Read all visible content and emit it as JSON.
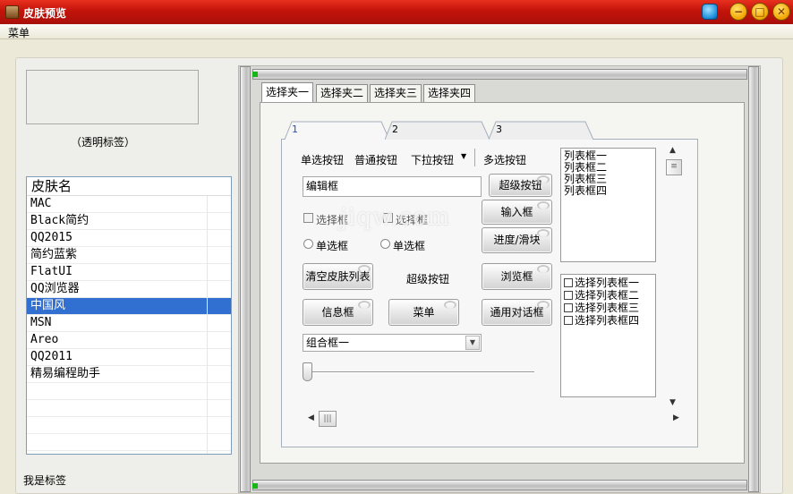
{
  "window": {
    "title": "皮肤预览",
    "minimize_glyph": "−",
    "maximize_glyph": "□",
    "close_glyph": "✕"
  },
  "menubar": {
    "menu_label": "菜单"
  },
  "left": {
    "transparent_label": "（透明标签）",
    "skin_list": {
      "header": "皮肤名",
      "items": [
        "MAC",
        "Black简约",
        "QQ2015",
        "简约蓝紫",
        "FlatUI",
        "QQ浏览器",
        "中国风",
        "MSN",
        "Areo",
        "QQ2011",
        "精易编程助手"
      ],
      "selected": "中国风"
    },
    "bottom_label": "我是标签"
  },
  "outer_tabs": [
    "选择夹一",
    "选择夹二",
    "选择夹三",
    "选择夹四"
  ],
  "inner_tabs": [
    "1",
    "2",
    "3"
  ],
  "controls": {
    "radio_button_label": "单选按钮",
    "normal_button_label": "普通按钮",
    "dropdown_button_label": "下拉按钮",
    "multi_select_label": "多选按钮",
    "edit_box_value": "编辑框",
    "super_button_top": "超级按钮",
    "input_box_button": "输入框",
    "progress_slider_button": "进度/滑块",
    "browse_box_button": "浏览框",
    "common_dialog_button": "通用对话框",
    "checkbox1": "选择框",
    "checkbox2": "选择框",
    "radio1": "单选框",
    "radio2": "单选框",
    "clear_skin_list_button": "清空皮肤列表",
    "super_button_label": "超级按钮",
    "info_box_button": "信息框",
    "menu_button": "菜单",
    "combo_value": "组合框一",
    "slider_value": 0
  },
  "list_box": [
    "列表框一",
    "列表框二",
    "列表框三",
    "列表框四"
  ],
  "check_list_box": [
    "选择列表框一",
    "选择列表框二",
    "选择列表框三",
    "选择列表框四"
  ],
  "watermark": "jiqw.com",
  "colors": {
    "titlebar": "#c3130a",
    "selection": "#3170d0",
    "accent_green": "#16b616"
  }
}
